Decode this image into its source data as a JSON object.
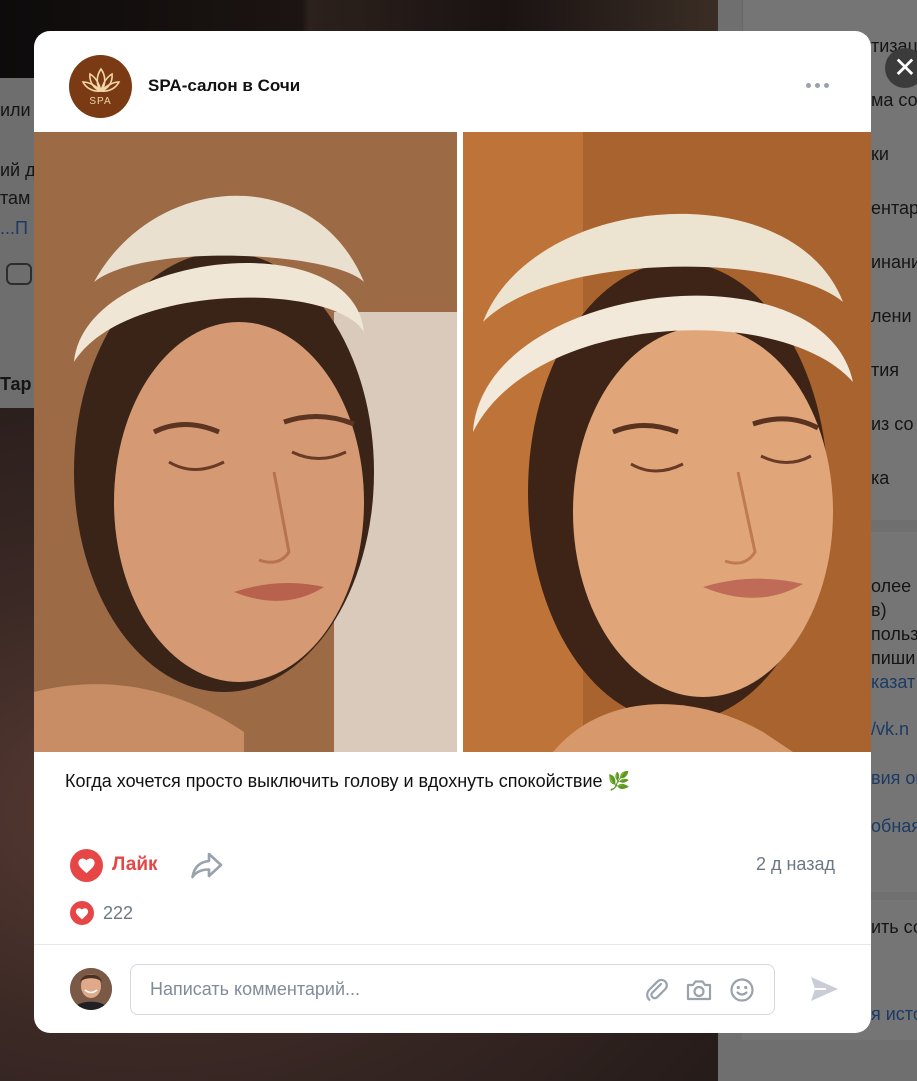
{
  "background": {
    "left_snippets": [
      "или",
      "ий д",
      "там",
      "...П",
      "Тар"
    ],
    "right_snippets": [
      "тизац",
      "ма со",
      "ки",
      "ентар",
      "инани",
      "лени",
      "тия",
      "из со",
      "ка",
      "олее 1",
      "в)",
      "польз",
      "пиши",
      "казат",
      "/vk.n",
      "вия он",
      "обная",
      "ить со",
      "я исто"
    ]
  },
  "post": {
    "group_name": "SPA-салон в Сочи",
    "logo_text": "SPA",
    "caption": "Когда хочется просто выключить голову и вдохнуть спокойствие",
    "caption_emoji": "🌿",
    "like_label": "Лайк",
    "time": "2 д назад",
    "likes_count": "222"
  },
  "comment": {
    "placeholder": "Написать комментарий..."
  },
  "icons": {
    "close": "close-icon",
    "more": "more-icon",
    "like": "heart-icon",
    "share": "share-icon",
    "attach": "paperclip-icon",
    "camera": "camera-icon",
    "emoji": "smile-icon",
    "send": "send-icon"
  },
  "colors": {
    "accent_red": "#e64646",
    "muted_text": "#6d7885",
    "logo_brown": "#7a3a14",
    "border": "#d3d9de"
  }
}
